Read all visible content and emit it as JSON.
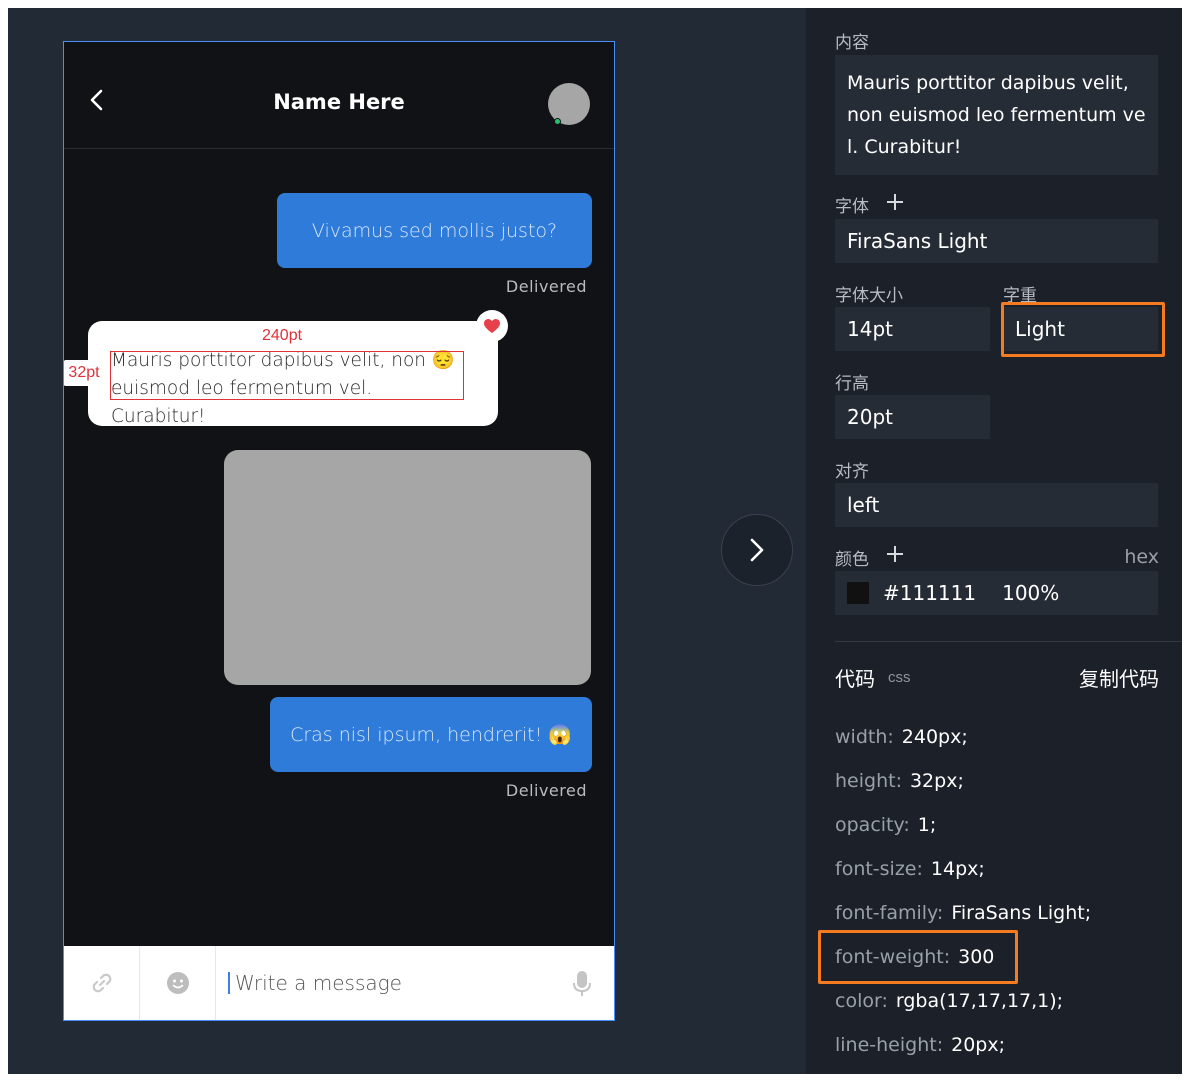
{
  "chat": {
    "contact_name": "Name Here",
    "messages": [
      {
        "text": "Vivamus sed mollis justo?",
        "status": "Delivered"
      },
      {
        "text": "Mauris porttitor dapibus velit, non 😔 euismod leo fermentum vel. Curabitur!"
      },
      {
        "text": "Cras nisl ipsum, hendrerit! 😱",
        "status": "Delivered"
      }
    ],
    "measure_width": "240pt",
    "measure_height": "32pt",
    "composer_placeholder": "Write a message",
    "icons": [
      "back-icon",
      "heart-icon",
      "link-icon",
      "emoji-icon",
      "mic-icon",
      "chevron-right-icon"
    ]
  },
  "inspector": {
    "content_label": "内容",
    "content_value": "Mauris porttitor dapibus velit, non euismod leo fermentum vel. Curabitur!",
    "font_label": "字体",
    "font_value": "FiraSans Light",
    "font_size_label": "字体大小",
    "font_size_value": "14pt",
    "font_weight_label": "字重",
    "font_weight_value": "Light",
    "line_height_label": "行高",
    "line_height_value": "20pt",
    "align_label": "对齐",
    "align_value": "left",
    "color_label": "颜色",
    "color_mode": "hex",
    "color_hex": "#111111",
    "color_opacity": "100%",
    "code_title": "代码",
    "code_lang": "css",
    "copy_label": "复制代码",
    "css": [
      {
        "prop": "width:",
        "value": "240px;"
      },
      {
        "prop": "height:",
        "value": "32px;"
      },
      {
        "prop": "opacity:",
        "value": "1;"
      },
      {
        "prop": "font-size:",
        "value": "14px;"
      },
      {
        "prop": "font-family:",
        "value": "FiraSans Light;"
      },
      {
        "prop": "font-weight:",
        "value": "300"
      },
      {
        "prop": "color:",
        "value": "rgba(17,17,17,1);"
      },
      {
        "prop": "line-height:",
        "value": "20px;"
      }
    ]
  },
  "colors": {
    "background": "#222a35",
    "outgoing_bubble": "#2f7bd9",
    "highlight": "#f47b20",
    "measure": "#e0303a"
  }
}
